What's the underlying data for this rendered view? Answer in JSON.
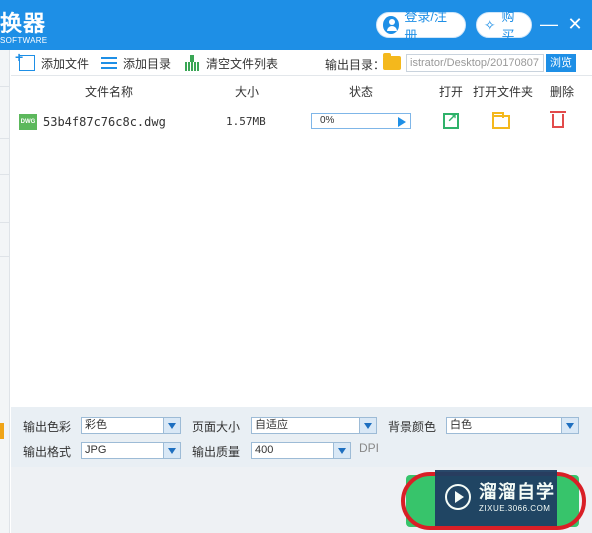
{
  "titlebar": {
    "title": "换器",
    "subtitle": "SOFTWARE",
    "login_label": "登录/注册",
    "buy_label": "购买",
    "minimize": "—",
    "close": "✕"
  },
  "toolbar": {
    "add_file": "添加文件",
    "add_dir": "添加目录",
    "clear_list": "清空文件列表",
    "output_dir_label": "输出目录：",
    "output_dir_value": "istrator/Desktop/20170807",
    "browse": "浏览"
  },
  "table": {
    "headers": {
      "name": "文件名称",
      "size": "大小",
      "status": "状态",
      "open": "打开",
      "open_folder": "打开文件夹",
      "delete": "删除"
    },
    "rows": [
      {
        "icon_text": "DWG",
        "name": "53b4f87c76c8c.dwg",
        "size": "1.57MB",
        "progress_text": "0%",
        "progress": 0
      }
    ]
  },
  "settings": {
    "color_label": "输出色彩",
    "color_value": "彩色",
    "pagesize_label": "页面大小",
    "pagesize_value": "自适应",
    "bg_label": "背景颜色",
    "bg_value": "白色",
    "format_label": "输出格式",
    "format_value": "JPG",
    "quality_label": "输出质量",
    "quality_value": "400",
    "dpi": "DPI"
  },
  "watermark": {
    "title": "溜溜自学",
    "sub": "ZIXUE.3066.COM"
  },
  "colors": {
    "accent": "#1e8fe6",
    "convert_green": "#37c46b",
    "highlight_red": "#d91f26"
  }
}
